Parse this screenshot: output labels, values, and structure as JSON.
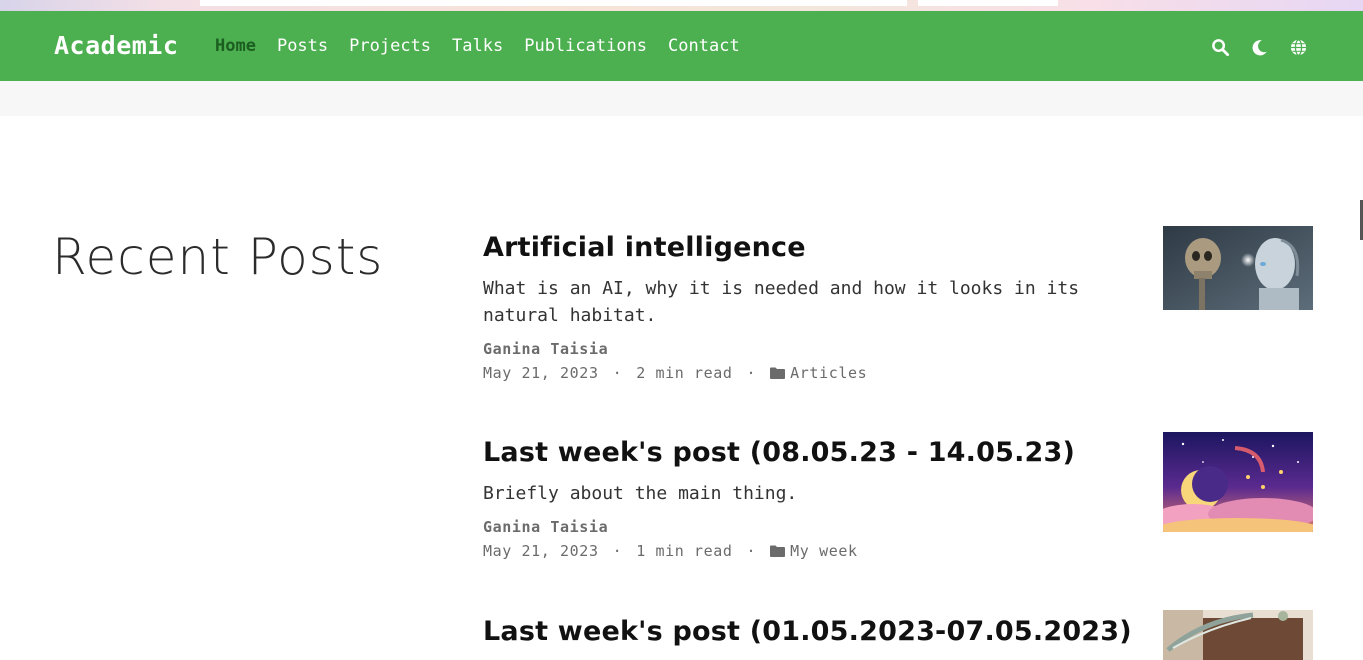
{
  "navbar": {
    "brand": "Academic",
    "links": [
      {
        "label": "Home",
        "active": true
      },
      {
        "label": "Posts"
      },
      {
        "label": "Projects"
      },
      {
        "label": "Talks"
      },
      {
        "label": "Publications"
      },
      {
        "label": "Contact"
      }
    ],
    "icons": [
      "search-icon",
      "moon-icon",
      "globe-icon"
    ],
    "color": "#4caf50",
    "active_color": "#1b5e20"
  },
  "section": {
    "title": "Recent Posts"
  },
  "posts": [
    {
      "title": "Artificial intelligence",
      "summary": "What is an AI, why it is needed and how it looks in its natural habitat.",
      "author": "Ganina Taisia",
      "date": "May 21, 2023",
      "read_time": "2 min read",
      "category": "Articles",
      "thumbnail": "ai-skull-robot-image"
    },
    {
      "title": "Last week's post (08.05.23 - 14.05.23)",
      "summary": "Briefly about the main thing.",
      "author": "Ganina Taisia",
      "date": "May 21, 2023",
      "read_time": "1 min read",
      "category": "My week",
      "thumbnail": "moon-night-sky-image"
    },
    {
      "title": "Last week's post (01.05.2023-07.05.2023)",
      "thumbnail": "notebook-feather-image"
    }
  ],
  "meta_separator": "·"
}
